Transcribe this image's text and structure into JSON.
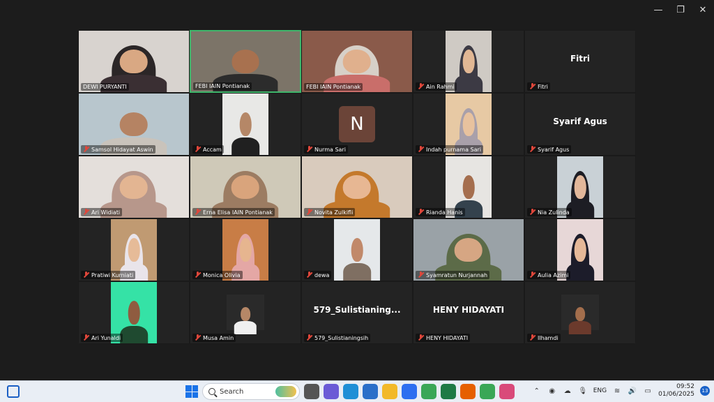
{
  "window_controls": {
    "minimize": "—",
    "restore": "❐",
    "close": "✕"
  },
  "participants": [
    {
      "name": "DEWI PURYANTI",
      "muted": false,
      "type": "video",
      "bg": "#d8d3cf",
      "skin": "#d9a883",
      "hijab": "#2b2627",
      "shirt": "#3a2f33",
      "frame": "full"
    },
    {
      "name": "FEBI IAIN Pontianak",
      "muted": false,
      "type": "video",
      "active": true,
      "bg": "#7c7468",
      "skin": "#a8714f",
      "hijab": "",
      "shirt": "#2c2c2c",
      "frame": "full"
    },
    {
      "name": "FEBI IAIN Pontianak",
      "muted": false,
      "type": "video",
      "bg": "#8a5a4a",
      "skin": "#e0b08d",
      "hijab": "#d7d0c8",
      "shirt": "#c96e6a",
      "frame": "full"
    },
    {
      "name": "Ain Rahmi",
      "muted": true,
      "type": "video",
      "bg": "#cfcac4",
      "skin": "#e1b794",
      "hijab": "#3c3a44",
      "shirt": "#3c3a44",
      "frame": "narrow"
    },
    {
      "name": "Fitri",
      "muted": true,
      "type": "name",
      "display": "Fitri"
    },
    {
      "name": "Samsol Hidayat Aswin",
      "muted": true,
      "type": "video",
      "bg": "#b8c6cd",
      "skin": "#b58363",
      "hijab": "",
      "shirt": "#c9c3bb",
      "frame": "full"
    },
    {
      "name": "Accam",
      "muted": true,
      "type": "video",
      "bg": "#e8e8e6",
      "skin": "#b58767",
      "hijab": "",
      "shirt": "#202020",
      "frame": "narrow"
    },
    {
      "name": "Nurma Sari",
      "muted": true,
      "type": "avatar",
      "initial": "N"
    },
    {
      "name": "Indah purnama Sari",
      "muted": true,
      "type": "video",
      "bg": "#e7c9a4",
      "skin": "#e8c29e",
      "hijab": "#a9a0aa",
      "shirt": "#a9a0aa",
      "frame": "narrow"
    },
    {
      "name": "Syarif Agus",
      "muted": true,
      "type": "name",
      "display": "Syarif Agus"
    },
    {
      "name": "Ari Widiati",
      "muted": true,
      "type": "video",
      "bg": "#e4dfdb",
      "skin": "#e3b592",
      "hijab": "#b7978b",
      "shirt": "#b7978b",
      "frame": "full"
    },
    {
      "name": "Erna Elisa IAIN Pontianak",
      "muted": true,
      "type": "video",
      "bg": "#cfc9b8",
      "skin": "#d9a47c",
      "hijab": "#9c7c62",
      "shirt": "#9c7c62",
      "frame": "full"
    },
    {
      "name": "Novita Zulkifli",
      "muted": true,
      "type": "video",
      "bg": "#d9cbbd",
      "skin": "#e7b793",
      "hijab": "#c4792c",
      "shirt": "#c4792c",
      "frame": "full"
    },
    {
      "name": "Rianda Hanis",
      "muted": true,
      "type": "video",
      "bg": "#e7e5e2",
      "skin": "#a56e4e",
      "hijab": "",
      "shirt": "#34424d",
      "frame": "narrow"
    },
    {
      "name": "Nia Zulinda",
      "muted": true,
      "type": "video",
      "bg": "#c9d1d6",
      "skin": "#e2b79a",
      "hijab": "#1d1d24",
      "shirt": "#1d1d24",
      "frame": "narrow"
    },
    {
      "name": "Pratiwi Kurniati",
      "muted": true,
      "type": "video",
      "bg": "#c09a72",
      "skin": "#e6bb98",
      "hijab": "#e9e4ea",
      "shirt": "#e9e4ea",
      "frame": "narrow"
    },
    {
      "name": "Monica Olivia",
      "muted": true,
      "type": "video",
      "bg": "#c87d46",
      "skin": "#e6b58f",
      "hijab": "#e4a7a5",
      "shirt": "#e4a7a5",
      "frame": "narrow"
    },
    {
      "name": "dewa",
      "muted": true,
      "type": "video",
      "bg": "#e5e8ea",
      "skin": "#c1896a",
      "hijab": "",
      "shirt": "#7f6f62",
      "frame": "narrow"
    },
    {
      "name": "Syamratun Nurjannah",
      "muted": true,
      "type": "video",
      "bg": "#9aa2a7",
      "skin": "#d6a683",
      "hijab": "#5c6b48",
      "shirt": "#5c6b48",
      "frame": "full"
    },
    {
      "name": "Aulia Azimi",
      "muted": true,
      "type": "video",
      "bg": "#e7d7d7",
      "skin": "#e5b898",
      "hijab": "#1c1c2a",
      "shirt": "#1c1c2a",
      "frame": "narrow"
    },
    {
      "name": "Ari Yunaldi",
      "muted": true,
      "type": "video",
      "bg": "#35e2a6",
      "skin": "#8f5c40",
      "hijab": "",
      "shirt": "#1f4a30",
      "frame": "narrow"
    },
    {
      "name": "Musa Amin",
      "muted": true,
      "type": "video",
      "bg": "#2a2a2a",
      "skin": "#b58767",
      "hijab": "",
      "shirt": "#f0f0f0",
      "frame": "small"
    },
    {
      "name": "579_Sulistianingsih",
      "muted": true,
      "type": "name",
      "display": "579_Sulistianing..."
    },
    {
      "name": "HENY HIDAYATI",
      "muted": true,
      "type": "name",
      "display": "HENY HIDAYATI"
    },
    {
      "name": "Ilhamdi",
      "muted": true,
      "type": "video",
      "bg": "#2a2a2a",
      "skin": "#a36e4c",
      "hijab": "",
      "shirt": "#6b3a2c",
      "frame": "small"
    }
  ],
  "taskbar": {
    "search_placeholder": "Search",
    "apps": [
      {
        "icon": "file-explorer-folder-icon",
        "color": "#555"
      },
      {
        "icon": "chat-icon",
        "color": "#6b5bd6"
      },
      {
        "icon": "edge-icon",
        "color": "#1f8fd6"
      },
      {
        "icon": "store-icon",
        "color": "#2a6fc9"
      },
      {
        "icon": "folder-icon",
        "color": "#f2b929"
      },
      {
        "icon": "zoom-icon",
        "color": "#2d6ff0"
      },
      {
        "icon": "chrome-icon",
        "color": "#3aa757"
      },
      {
        "icon": "excel-icon",
        "color": "#1f7a45"
      },
      {
        "icon": "firefox-icon",
        "color": "#e66000"
      },
      {
        "icon": "chrome-icon",
        "color": "#3aa757"
      },
      {
        "icon": "snipping-tool-icon",
        "color": "#d94a7a"
      }
    ],
    "language": "ENG",
    "time": "09:52",
    "date": "01/06/2025",
    "notifications": "13"
  }
}
